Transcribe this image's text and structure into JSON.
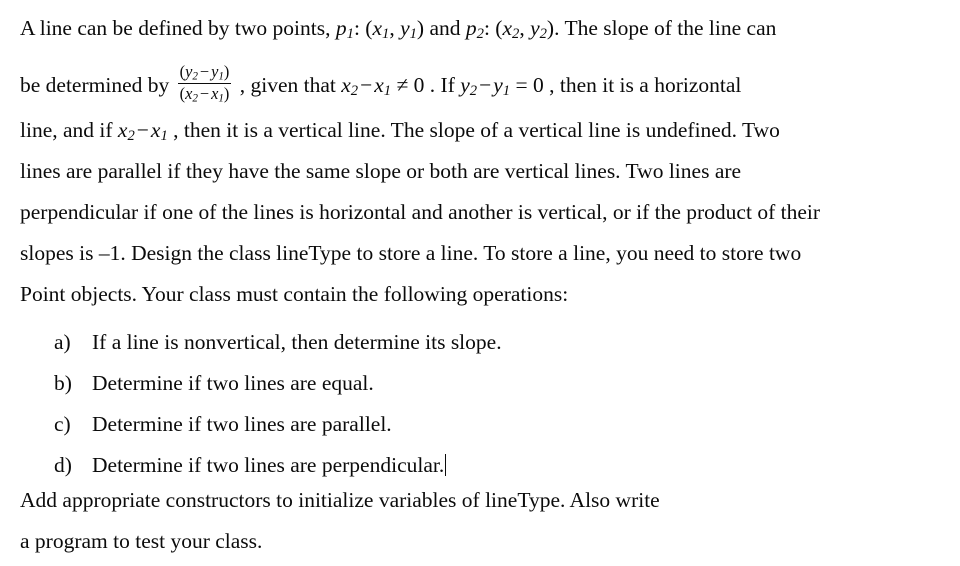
{
  "document": {
    "type": "exercise-prompt",
    "background_color": "#ffffff",
    "text_color": "#0b0b0b",
    "body": {
      "line1_a": "A line  can be defined by two points, ",
      "line1_p1": "p",
      "line1_p1_sub": "1",
      "line1_b": ": (",
      "line1_x1": "x",
      "line1_x1_sub": "1",
      "line1_comma": ", ",
      "line1_y1": "y",
      "line1_y1_sub": "1",
      "line1_c": ") and ",
      "line1_p2": "p",
      "line1_p2_sub": "2",
      "line1_d": ": (",
      "line1_x2": "x",
      "line1_x2_sub": "2",
      "line1_comma2": ", ",
      "line1_y2": "y",
      "line1_y2_sub": "2",
      "line1_e": "). The slope of the line can",
      "line2_a": "be determined by ",
      "frac_num_open": "(",
      "frac_num_y2": "y",
      "frac_num_y2_sub": "2",
      "frac_num_minus": "−",
      "frac_num_y1": "y",
      "frac_num_y1_sub": "1",
      "frac_num_close": ")",
      "frac_den_open": "(",
      "frac_den_x2": "x",
      "frac_den_x2_sub": "2",
      "frac_den_minus": "−",
      "frac_den_x1": "x",
      "frac_den_x1_sub": "1",
      "frac_den_close": ")",
      "line2_b": " , given that ",
      "line2_x2": "x",
      "line2_x2_sub": "2",
      "line2_minus": "−",
      "line2_x1": "x",
      "line2_x1_sub": "1",
      "line2_c": " ≠ 0 . If ",
      "line2_y2": "y",
      "line2_y2_sub": "2",
      "line2_minus2": "−",
      "line2_y1": "y",
      "line2_y1_sub": "1",
      "line2_d": " = 0 , then it is a horizontal",
      "line3_a": "line, and if ",
      "line3_x2": "x",
      "line3_x2_sub": "2",
      "line3_minus": "−",
      "line3_x1": "x",
      "line3_x1_sub": "1",
      "line3_b": " , then it is a vertical line. The slope of a vertical line is undefined. Two",
      "line4": "lines are parallel if they have the same slope or both are vertical lines. Two lines are",
      "line5": "perpendicular if one of the lines is horizontal and another is vertical, or if the product of their",
      "line6": "slopes is –1. Design the class lineType to store a line. To store a line, you need to store two",
      "line7": "Point objects. Your class must contain the following operations:",
      "closing_line1": "Add appropriate constructors to initialize variables of lineType. Also write",
      "closing_line2": "a program to test your class."
    },
    "list": {
      "items": [
        {
          "marker": "a)",
          "text": "If a line is nonvertical, then determine its slope."
        },
        {
          "marker": "b)",
          "text": "Determine if two lines are equal."
        },
        {
          "marker": "c)",
          "text": "Determine if two lines are parallel."
        },
        {
          "marker": "d)",
          "text": "Determine if two lines are perpendicular."
        }
      ]
    },
    "caret": {
      "present": true,
      "after_item": "d)"
    }
  }
}
